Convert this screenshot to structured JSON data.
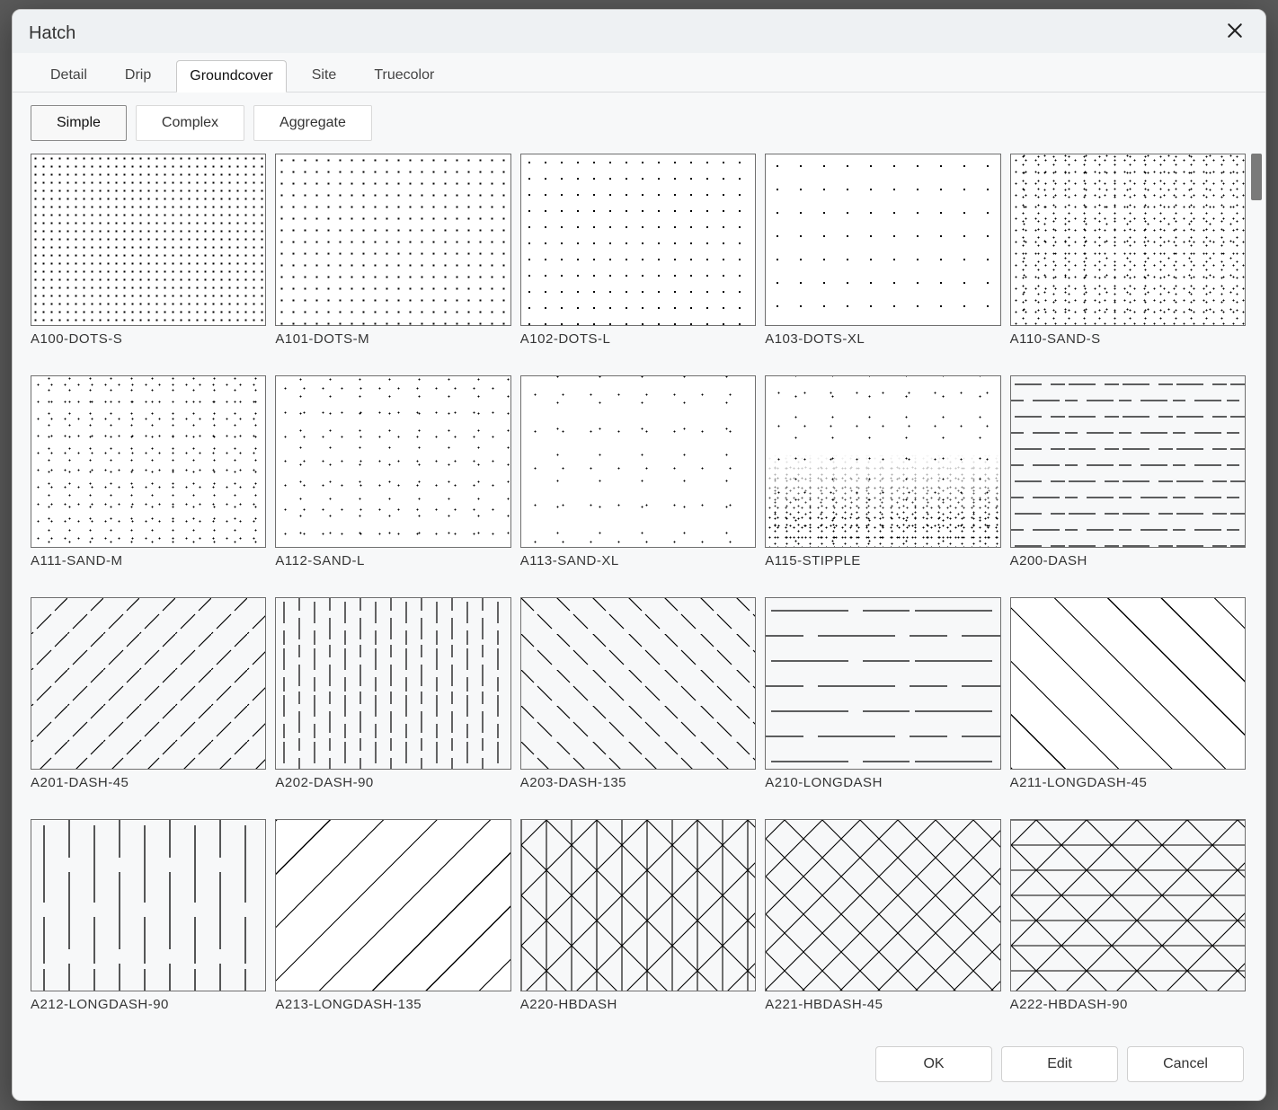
{
  "dialog": {
    "title": "Hatch"
  },
  "tabs": [
    {
      "label": "Detail",
      "active": false
    },
    {
      "label": "Drip",
      "active": false
    },
    {
      "label": "Groundcover",
      "active": true
    },
    {
      "label": "Site",
      "active": false
    },
    {
      "label": "Truecolor",
      "active": false
    }
  ],
  "subtabs": [
    {
      "label": "Simple",
      "active": true
    },
    {
      "label": "Complex",
      "active": false
    },
    {
      "label": "Aggregate",
      "active": false
    }
  ],
  "swatches": [
    {
      "label": "A100-DOTS-S",
      "klass": "pat-dots-s"
    },
    {
      "label": "A101-DOTS-M",
      "klass": "pat-dots-m"
    },
    {
      "label": "A102-DOTS-L",
      "klass": "pat-dots-l"
    },
    {
      "label": "A103-DOTS-XL",
      "klass": "pat-dots-xl"
    },
    {
      "label": "A110-SAND-S",
      "klass": "pat-sand-s"
    },
    {
      "label": "A111-SAND-M",
      "klass": "pat-sand-m"
    },
    {
      "label": "A112-SAND-L",
      "klass": "pat-sand-l"
    },
    {
      "label": "A113-SAND-XL",
      "klass": "pat-sand-xl"
    },
    {
      "label": "A115-STIPPLE",
      "klass": "pat-stipple"
    },
    {
      "label": "A200-DASH",
      "klass": "pat-dash"
    },
    {
      "label": "A201-DASH-45",
      "klass": "pat-dash-45"
    },
    {
      "label": "A202-DASH-90",
      "klass": "pat-dash-90"
    },
    {
      "label": "A203-DASH-135",
      "klass": "pat-dash-135"
    },
    {
      "label": "A210-LONGDASH",
      "klass": "pat-longdash"
    },
    {
      "label": "A211-LONGDASH-45",
      "klass": "pat-longdash-45"
    },
    {
      "label": "A212-LONGDASH-90",
      "klass": "pat-longdash-90"
    },
    {
      "label": "A213-LONGDASH-135",
      "klass": "pat-longdash-135"
    },
    {
      "label": "A220-HBDASH",
      "klass": "pat-hbdash"
    },
    {
      "label": "A221-HBDASH-45",
      "klass": "pat-hbdash-45"
    },
    {
      "label": "A222-HBDASH-90",
      "klass": "pat-hbdash-90"
    }
  ],
  "footer": {
    "ok": "OK",
    "edit": "Edit",
    "cancel": "Cancel"
  }
}
